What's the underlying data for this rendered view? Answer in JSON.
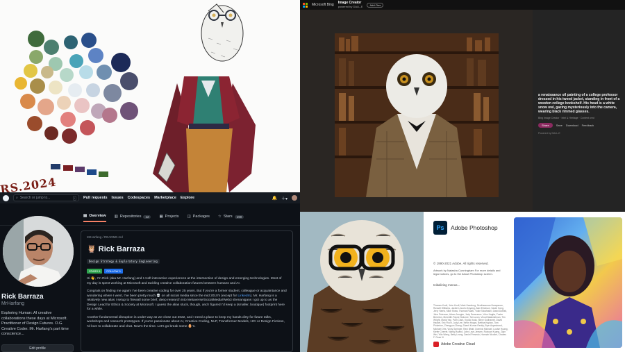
{
  "sketch": {
    "signature": "RS.2024"
  },
  "bing": {
    "brand": "Microsoft Bing",
    "product": "Image Creator",
    "product_sub": "powered by DALL-E",
    "pill": "Add-Ons",
    "prompt": "a renaissance oil painting of a college professor dressed in his tweed jacket, standing in front of a wooden college bookshelf. His head is a white snow owl, gazing mysteriously into the camera, wearing black rimmed glasses.",
    "meta": "Bing Image Creator  ·  Intel & Heritage  ·  Content cred",
    "share": "Share",
    "save": "Save",
    "download": "Download",
    "feedback": "Feedback",
    "footer": "Powered by DALL-E"
  },
  "github": {
    "search_placeholder": "Search or jump to...",
    "search_key": "/",
    "nav": [
      "Pull requests",
      "Issues",
      "Codespaces",
      "Marketplace",
      "Explore"
    ],
    "tabs": [
      {
        "label": "Overview",
        "count": ""
      },
      {
        "label": "Repositories",
        "count": "12"
      },
      {
        "label": "Projects",
        "count": ""
      },
      {
        "label": "Packages",
        "count": ""
      },
      {
        "label": "Stars",
        "count": "190"
      }
    ],
    "name": "Rick Barraza",
    "handle": "MrHarfang",
    "bio": "Exploring Human::AI creative collaborations these days at Microsoft. Practitioner of Design Futures. O.G. Creative Coder. Mr. Harfang's part time conscience...",
    "edit_profile": "Edit profile",
    "readme_path": "MrHarfang / README.md",
    "readme_title": "🦉 Rick Barraza",
    "readme_subtitle": "Design Strategy & Exploratory Engineering",
    "badge_stars": "STARS",
    "badge_stars_count": "9",
    "badge_follow": "FOLLOW",
    "badge_follow_count": "9",
    "para1": "Hi 👋, I'm Rick (aka Mr. Harfang) and I craft interactive experiences at the intersection of design and emerging technologies. Most of my day is spent working at Microsoft and tackling creative collaboration futures between humans and AI.",
    "para2a": "Congrats on finding me again! I've been creative coding for over 25 years. But if you're a former student, colleague or acquaintance and wondering where I went, I've been pretty much 💀 on all social media since the mid 2010's (except for ",
    "para2_link": "LinkedIn",
    "para2b": "). Mr. Harfang is a relatively new alias I setup to firewall some brief, deep research into Metaverse/SocialMedia/Web3 shenanigans I got up to as the Design Lead for Ethics & Society at Microsoft. I guess the alias stuck, though, and I figured I'd keep a (smaller, boutique) footprint here for a while.",
    "para3": "Another fundamental disruption is under way as we close out 2022, and I need a place to keep my hands dirty for future talks, workshops and research prototypes. If you're passionate about AI, Creative Coding, NLP, Transformer Models, HCI or Design Fictions, I'd love to collaborate and chat. Now's the time. Let's go break some 🥚's."
  },
  "photoshop": {
    "logo": "Ps",
    "name": "Adobe Photoshop",
    "copyright": "© 1990-2021 Adobe. All rights reserved.",
    "artwork": "Artwork by Natasha Cunningham For more details and legal notices, go to the About Photoshop screen.",
    "initializing": "Initializing menus...",
    "credits": "Thomas Knoll, John Knoll, Mark Hamburg, Seetharaman Narayanan, Russell Williams, Jackie Lincoln-Owyang, Alan Erickson, Sarah Kong, Jerry Harris, Mike Shaw, Thomas Ruark, Yukie Takahashi, David Dobish, John Peterson, Adam Jerugim, Judy Severance, Yuko Kagita, Foster Brereton, Meredith Payne Stotzner, Tai Luxon, Vinod Balakrishnan, Tim Wright, Maria Yap, Pam Clark, Kyoko Itoda, Steve Guilhamet, David Hackel, Eric Floch, Judy Lee, Kevin Hopps, Bettina Kaplan, Tom Pinkerton, Zhengyun Zhang, Shanti Kumar Reddy, Bryn Aspestrand, Michael Orts, Vicky Springer, Ravi Bhatt, Dominic Michael, Louise Huang, Kiefer Cherrie, Nandy Anand, John Love-Jensen, Ruixuan Kuang, Zijun Wei, Yilin Wang, Betty Leong, Daniel Presedo, Hannah Nicollet, Charles F. Rose III",
    "creative_cloud": "Adobe Creative Cloud"
  }
}
